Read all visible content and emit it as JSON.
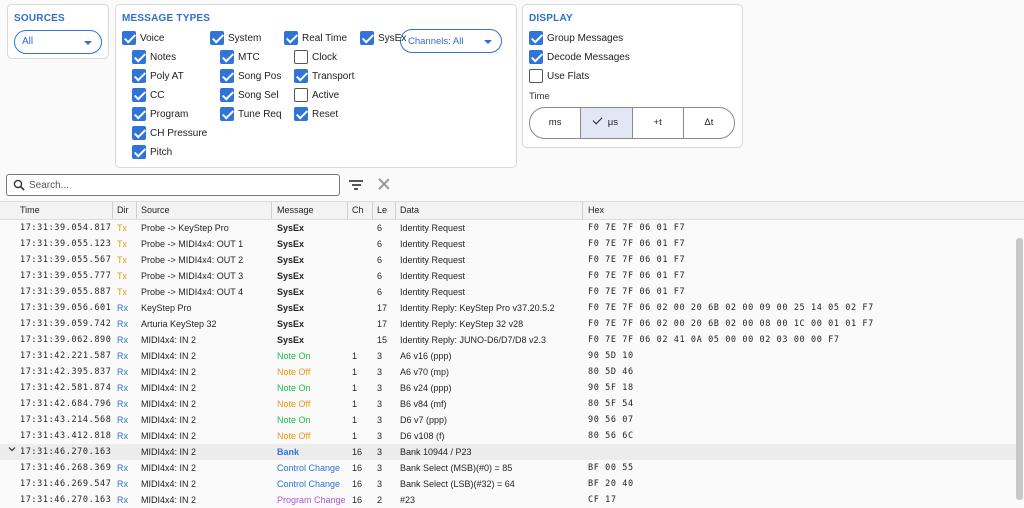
{
  "sources": {
    "title": "SOURCES",
    "selected": "All"
  },
  "types": {
    "title": "MESSAGE TYPES",
    "channels": "Channels: All",
    "checks": [
      {
        "label": "Voice",
        "on": true
      },
      {
        "label": "Notes",
        "on": true
      },
      {
        "label": "Poly AT",
        "on": true
      },
      {
        "label": "CC",
        "on": true
      },
      {
        "label": "Program",
        "on": true
      },
      {
        "label": "CH Pressure",
        "on": true
      },
      {
        "label": "Pitch",
        "on": true
      },
      {
        "label": "System",
        "on": true
      },
      {
        "label": "MTC",
        "on": true
      },
      {
        "label": "Song Pos",
        "on": true
      },
      {
        "label": "Song Sel",
        "on": true
      },
      {
        "label": "Tune Req",
        "on": true
      },
      {
        "label": "Real Time",
        "on": true
      },
      {
        "label": "Clock",
        "on": false
      },
      {
        "label": "Transport",
        "on": true
      },
      {
        "label": "Active",
        "on": false
      },
      {
        "label": "Reset",
        "on": true
      },
      {
        "label": "SysEx",
        "on": true
      }
    ]
  },
  "display": {
    "title": "DISPLAY",
    "checks": [
      {
        "label": "Group Messages",
        "on": true
      },
      {
        "label": "Decode Messages",
        "on": true
      },
      {
        "label": "Use Flats",
        "on": false
      }
    ],
    "time_label": "Time",
    "time_options": [
      "ms",
      "μs",
      "+t",
      "Δt"
    ],
    "time_selected": "μs"
  },
  "search": {
    "placeholder": "Search...",
    "filter_icon": "filter-icon",
    "clear_icon": "close-icon"
  },
  "colors": {
    "accent": "#2f74d6",
    "tx": "#e8a317",
    "rx": "#2f74d6",
    "note_on": "#22b84c",
    "note_off": "#f0960e",
    "bank": "#2f74d6",
    "program_change": "#b455d6"
  },
  "table": {
    "headers": [
      "Time",
      "Dir",
      "Source",
      "Message",
      "Ch",
      "Le",
      "Data",
      "Hex"
    ],
    "rows": [
      {
        "time": "17:31:39.054.817",
        "dir": "Tx",
        "source": "Probe -> KeyStep Pro",
        "message": "SysEx",
        "ch": "",
        "len": "6",
        "data": "Identity Request",
        "hex": "F0 7E 7F 06 01 F7"
      },
      {
        "time": "17:31:39.055.123",
        "dir": "Tx",
        "source": "Probe -> MIDI4x4: OUT 1",
        "message": "SysEx",
        "ch": "",
        "len": "6",
        "data": "Identity Request",
        "hex": "F0 7E 7F 06 01 F7"
      },
      {
        "time": "17:31:39.055.567",
        "dir": "Tx",
        "source": "Probe -> MIDI4x4: OUT 2",
        "message": "SysEx",
        "ch": "",
        "len": "6",
        "data": "Identity Request",
        "hex": "F0 7E 7F 06 01 F7"
      },
      {
        "time": "17:31:39.055.777",
        "dir": "Tx",
        "source": "Probe -> MIDI4x4: OUT 3",
        "message": "SysEx",
        "ch": "",
        "len": "6",
        "data": "Identity Request",
        "hex": "F0 7E 7F 06 01 F7"
      },
      {
        "time": "17:31:39.055.887",
        "dir": "Tx",
        "source": "Probe -> MIDI4x4: OUT 4",
        "message": "SysEx",
        "ch": "",
        "len": "6",
        "data": "Identity Request",
        "hex": "F0 7E 7F 06 01 F7"
      },
      {
        "time": "17:31:39.056.601",
        "dir": "Rx",
        "source": "KeyStep Pro",
        "message": "SysEx",
        "ch": "",
        "len": "17",
        "data": "Identity Reply: KeyStep Pro v37.20.5.2",
        "hex": "F0 7E 7F 06 02 00 20 6B 02 00 09 00 25 14 05 02 F7"
      },
      {
        "time": "17:31:39.059.742",
        "dir": "Rx",
        "source": "Arturia KeyStep 32",
        "message": "SysEx",
        "ch": "",
        "len": "17",
        "data": "Identity Reply: KeyStep 32 v28",
        "hex": "F0 7E 7F 06 02 00 20 6B 02 00 08 00 1C 00 01 01 F7"
      },
      {
        "time": "17:31:39.062.890",
        "dir": "Rx",
        "source": "MIDI4x4: IN 2",
        "message": "SysEx",
        "ch": "",
        "len": "15",
        "data": "Identity Reply: JUNO-D6/D7/D8 v2.3",
        "hex": "F0 7E 7F 06 02 41 0A 05 00 00 02 03 00 00 F7"
      },
      {
        "time": "17:31:42.221.587",
        "dir": "Rx",
        "source": "MIDI4x4: IN 2",
        "message": "Note On",
        "ch": "1",
        "len": "3",
        "data": "A6 v16 (ppp)",
        "hex": "90 5D 10"
      },
      {
        "time": "17:31:42.395.837",
        "dir": "Rx",
        "source": "MIDI4x4: IN 2",
        "message": "Note Off",
        "ch": "1",
        "len": "3",
        "data": "A6 v70 (mp)",
        "hex": "80 5D 46"
      },
      {
        "time": "17:31:42.581.874",
        "dir": "Rx",
        "source": "MIDI4x4: IN 2",
        "message": "Note On",
        "ch": "1",
        "len": "3",
        "data": "B6 v24 (ppp)",
        "hex": "90 5F 18"
      },
      {
        "time": "17:31:42.684.796",
        "dir": "Rx",
        "source": "MIDI4x4: IN 2",
        "message": "Note Off",
        "ch": "1",
        "len": "3",
        "data": "B6 v84 (mf)",
        "hex": "80 5F 54"
      },
      {
        "time": "17:31:43.214.568",
        "dir": "Rx",
        "source": "MIDI4x4: IN 2",
        "message": "Note On",
        "ch": "1",
        "len": "3",
        "data": "D6 v7 (ppp)",
        "hex": "90 56 07"
      },
      {
        "time": "17:31:43.412.818",
        "dir": "Rx",
        "source": "MIDI4x4: IN 2",
        "message": "Note Off",
        "ch": "1",
        "len": "3",
        "data": "D6 v108 (f)",
        "hex": "80 56 6C"
      },
      {
        "time": "17:31:46.270.163",
        "dir": "",
        "source": "MIDI4x4: IN 2",
        "message": "Bank",
        "ch": "16",
        "len": "3",
        "data": "Bank 10944 / P23",
        "hex": "",
        "group": true,
        "expanded": true
      },
      {
        "time": "17:31:46.268.369",
        "dir": "Rx",
        "source": "MIDI4x4: IN 2",
        "message": "Control Change",
        "ch": "16",
        "len": "3",
        "data": "Bank Select (MSB)(#0) = 85",
        "hex": "BF 00 55"
      },
      {
        "time": "17:31:46.269.547",
        "dir": "Rx",
        "source": "MIDI4x4: IN 2",
        "message": "Control Change",
        "ch": "16",
        "len": "3",
        "data": "Bank Select (LSB)(#32) = 64",
        "hex": "BF 20 40"
      },
      {
        "time": "17:31:46.270.163",
        "dir": "Rx",
        "source": "MIDI4x4: IN 2",
        "message": "Program Change",
        "ch": "16",
        "len": "2",
        "data": "#23",
        "hex": "CF 17"
      }
    ]
  }
}
